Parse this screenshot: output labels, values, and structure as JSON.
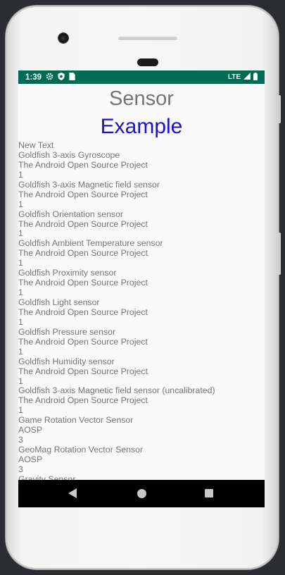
{
  "statusbar": {
    "time": "1:39",
    "icons_left": [
      "gear-icon",
      "shield-icon",
      "sim-card-icon"
    ],
    "network": "LTE",
    "icons_right": [
      "signal-icon",
      "battery-icon"
    ]
  },
  "app": {
    "title": "Sensor",
    "subtitle": "Example"
  },
  "lines": [
    "New Text",
    "Goldfish 3-axis Gyroscope",
    "The Android Open Source Project",
    "1",
    "Goldfish 3-axis Magnetic field sensor",
    "The Android Open Source Project",
    "1",
    "Goldfish Orientation sensor",
    "The Android Open Source Project",
    "1",
    "Goldfish Ambient Temperature sensor",
    "The Android Open Source Project",
    "1",
    "Goldfish Proximity sensor",
    "The Android Open Source Project",
    "1",
    "Goldfish Light sensor",
    "The Android Open Source Project",
    "1",
    "Goldfish Pressure sensor",
    "The Android Open Source Project",
    "1",
    "Goldfish Humidity sensor",
    "The Android Open Source Project",
    "1",
    "Goldfish 3-axis Magnetic field sensor (uncalibrated)",
    "The Android Open Source Project",
    "1",
    "Game Rotation Vector Sensor",
    "AOSP",
    "3",
    "GeoMag Rotation Vector Sensor",
    "AOSP",
    "3",
    "Gravity Sensor"
  ],
  "colors": {
    "statusbar": "#006a52",
    "title": "#757575",
    "subtitle": "#1a12d6",
    "text": "#757575"
  }
}
